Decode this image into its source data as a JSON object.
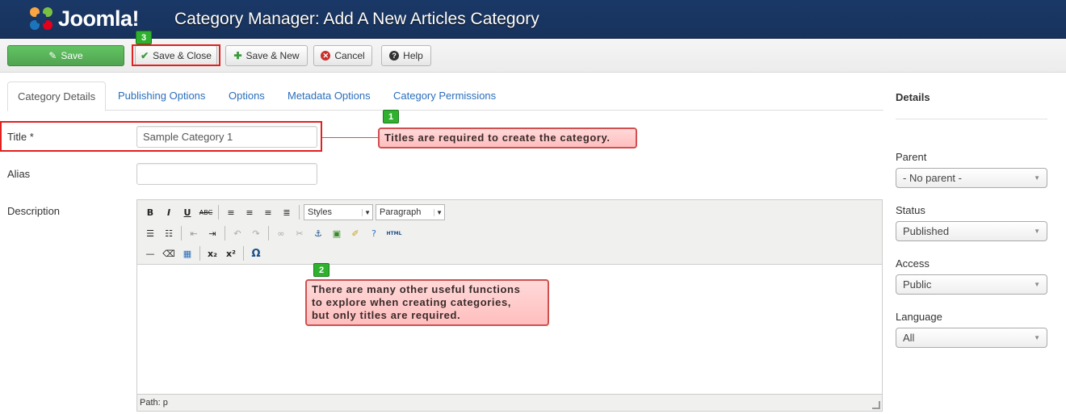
{
  "header": {
    "logo_text": "Joomla!",
    "page_title": "Category Manager: Add A New Articles Category"
  },
  "toolbar": {
    "save_label": "Save",
    "save_close_label": "Save & Close",
    "save_new_label": "Save & New",
    "cancel_label": "Cancel",
    "help_label": "Help"
  },
  "tabs": [
    {
      "label": "Category Details",
      "active": true
    },
    {
      "label": "Publishing Options"
    },
    {
      "label": "Options"
    },
    {
      "label": "Metadata Options"
    },
    {
      "label": "Category Permissions"
    }
  ],
  "form": {
    "title_label": "Title *",
    "title_value": "Sample Category 1",
    "alias_label": "Alias",
    "alias_value": "",
    "description_label": "Description"
  },
  "editor": {
    "styles_select": "Styles",
    "format_select": "Paragraph",
    "status_path": "Path: p",
    "html_button": "HTML"
  },
  "annotations": {
    "badge_1": "1",
    "badge_2": "2",
    "badge_3": "3",
    "callout_1": "Titles are required to create the category.",
    "callout_2_line1": "There are many other useful functions",
    "callout_2_line2": "to explore when creating categories,",
    "callout_2_line3": "but only titles are required."
  },
  "sidebar": {
    "title": "Details",
    "parent_label": "Parent",
    "parent_value": "- No parent -",
    "status_label": "Status",
    "status_value": "Published",
    "access_label": "Access",
    "access_value": "Public",
    "language_label": "Language",
    "language_value": "All"
  },
  "colors": {
    "header_bg": "#1a3867",
    "save_green": "#51a351",
    "highlight_red": "#e12020",
    "callout_pink": "#ffbebe",
    "badge_green": "#2fb12f",
    "link_blue": "#2a6ebb"
  }
}
